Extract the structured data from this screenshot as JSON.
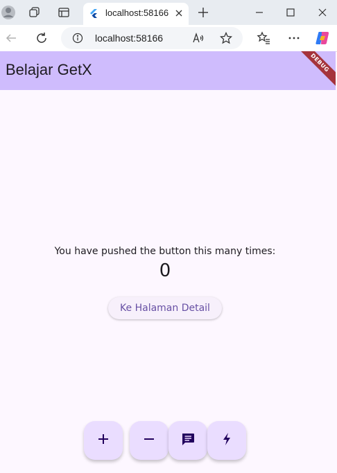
{
  "browser": {
    "tab": {
      "title": "localhost:58166",
      "favicon": "flutter-icon"
    },
    "address_bar": {
      "url": "localhost:58166"
    },
    "icons": [
      "profile-icon",
      "workspaces-icon",
      "vertical-tabs-icon",
      "new-tab-icon",
      "minimize-icon",
      "maximize-icon",
      "close-icon",
      "back-icon",
      "refresh-icon",
      "site-info-icon",
      "read-aloud-icon",
      "favorite-star-icon",
      "favorites-icon",
      "more-icon",
      "copilot-icon"
    ]
  },
  "app": {
    "title": "Belajar GetX",
    "debug_banner": "DEBUG",
    "counter_label": "You have pushed the button this many times:",
    "counter_value": "0",
    "detail_button_label": "Ke Halaman Detail",
    "fabs": [
      "add-icon",
      "remove-icon",
      "message-icon",
      "flash-icon"
    ]
  },
  "colors": {
    "appbar": "#cfbcfd",
    "background": "#fdf7ff",
    "fab": "#eaddff",
    "accent": "#6750a4",
    "debug_ribbon": "#a5333c"
  }
}
